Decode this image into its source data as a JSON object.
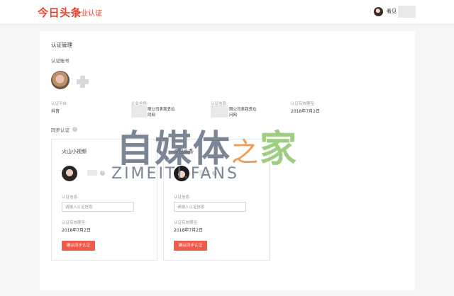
{
  "topbar": {
    "logo": "今日头条",
    "subtitle": "企业认证",
    "username": "看见"
  },
  "main": {
    "title": "认证管理",
    "account_section": "认证账号",
    "info": [
      {
        "label": "认证平台:",
        "value": "抖音"
      },
      {
        "label": "企业全称:",
        "value": "限公司表我丢拉\n同网"
      },
      {
        "label": "认证信息:",
        "value": "限公司表我丢拉\n问网"
      },
      {
        "label": "认证有效期至:",
        "value": "2018年7月2日"
      }
    ],
    "sync_section": "同步认证",
    "help_icon": "question-circle-icon",
    "sync_cards": [
      {
        "platform": "火山小视频",
        "info_label": "认证信息:",
        "placeholder": "请输入认证信息",
        "validity_label": "认证有效期至:",
        "validity_value": "2018年7月2日",
        "button": "确认同步认证"
      },
      {
        "platform": "今日头条",
        "info_label": "认证信息:",
        "placeholder": "请输入认证信息",
        "validity_label": "认证有效期至:",
        "validity_value": "2018年7月2日",
        "button": "确认同步认证"
      }
    ]
  },
  "watermark": {
    "main": "自媒体之家",
    "sub": "ZIMEITI.FANS"
  },
  "colors": {
    "accent": "#e8412f",
    "button": "#f05a4b",
    "watermark_blue": "#5d6b7e",
    "watermark_green": "#8cc56b",
    "watermark_orange": "#f08a35"
  }
}
